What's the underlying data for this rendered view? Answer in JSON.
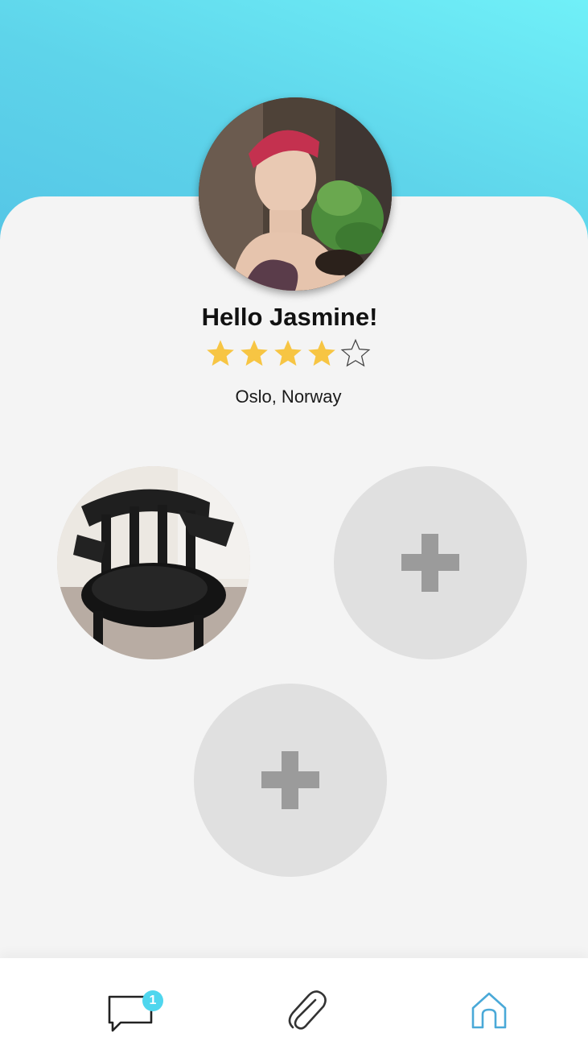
{
  "profile": {
    "greeting": "Hello Jasmine!",
    "location": "Oslo, Norway",
    "rating": 4,
    "rating_max": 5,
    "avatar_icon": "user-avatar-photo"
  },
  "photos": [
    {
      "kind": "filled",
      "icon": "chair-photo"
    },
    {
      "kind": "empty",
      "icon": "plus-icon"
    },
    {
      "kind": "empty",
      "icon": "plus-icon"
    }
  ],
  "nav": {
    "items": [
      {
        "name": "messages",
        "icon": "chat-bubble-icon",
        "badge": "1"
      },
      {
        "name": "attachments",
        "icon": "paperclip-icon"
      },
      {
        "name": "home",
        "icon": "home-icon",
        "active": true
      }
    ]
  },
  "colors": {
    "header_top": "#70f0f8",
    "header_bottom": "#55c6e6",
    "star_filled": "#f7c543",
    "star_empty_outline": "#444444",
    "badge": "#4fd6ee",
    "active_nav": "#4aa9d8",
    "plus": "#9b9b9b",
    "empty_slot": "#e0e0e0"
  }
}
